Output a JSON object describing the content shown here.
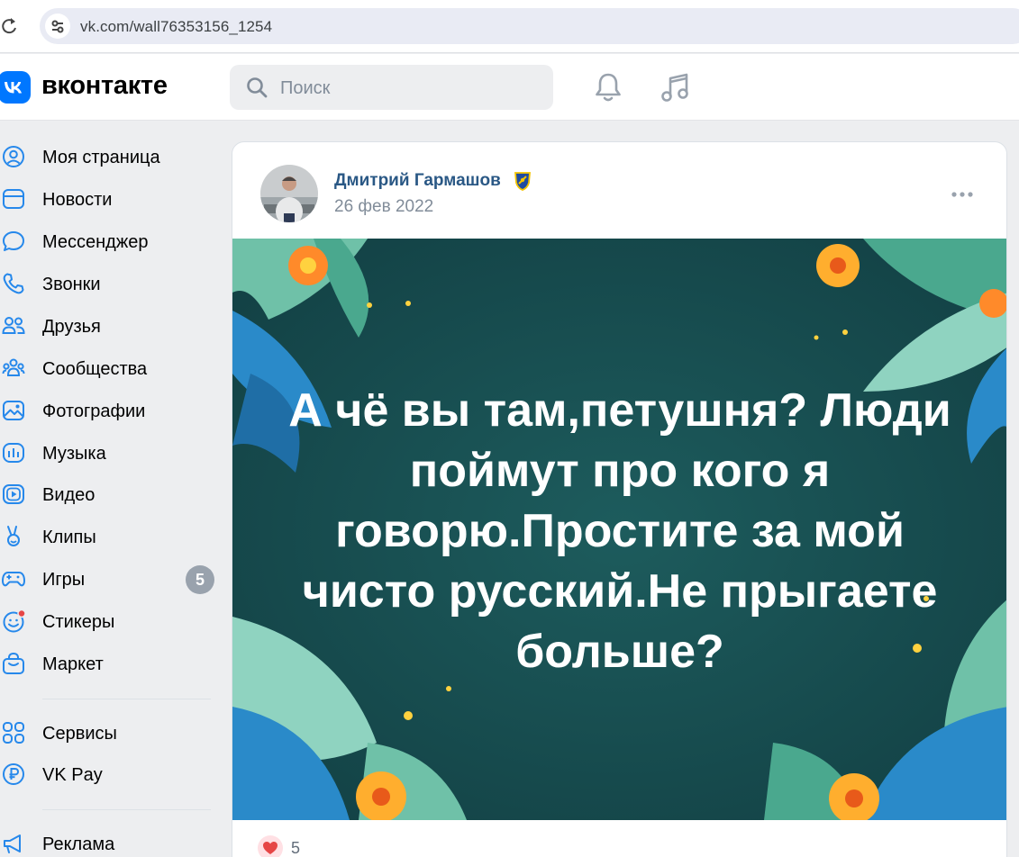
{
  "browser": {
    "url": "vk.com/wall76353156_1254"
  },
  "header": {
    "logo_text": "вконтакте",
    "search_placeholder": "Поиск"
  },
  "sidebar": {
    "items": [
      {
        "label": "Моя страница",
        "icon": "user-circle-icon"
      },
      {
        "label": "Новости",
        "icon": "news-icon"
      },
      {
        "label": "Мессенджер",
        "icon": "message-icon"
      },
      {
        "label": "Звонки",
        "icon": "phone-icon"
      },
      {
        "label": "Друзья",
        "icon": "friends-icon"
      },
      {
        "label": "Сообщества",
        "icon": "communities-icon"
      },
      {
        "label": "Фотографии",
        "icon": "photo-icon"
      },
      {
        "label": "Музыка",
        "icon": "music-icon"
      },
      {
        "label": "Видео",
        "icon": "video-icon"
      },
      {
        "label": "Клипы",
        "icon": "clips-icon"
      },
      {
        "label": "Игры",
        "icon": "gamepad-icon",
        "badge": "5"
      },
      {
        "label": "Стикеры",
        "icon": "sticker-icon"
      },
      {
        "label": "Маркет",
        "icon": "bag-icon"
      }
    ],
    "secondary": [
      {
        "label": "Сервисы",
        "icon": "services-icon"
      },
      {
        "label": "VK Pay",
        "icon": "ruble-icon"
      }
    ],
    "tertiary": [
      {
        "label": "Реклама",
        "icon": "megaphone-icon"
      }
    ]
  },
  "post": {
    "author": "Дмитрий Гармашов",
    "date": "26 фев 2022",
    "image_text": "А чё вы там,петушня? Люди поймут про кого я говорю.Простите за мой чисто русский.Не прыгаете больше?",
    "likes": "5"
  },
  "colors": {
    "accent": "#0077ff",
    "link": "#2a5885",
    "image_background": "#184d50",
    "like": "#e64646"
  }
}
